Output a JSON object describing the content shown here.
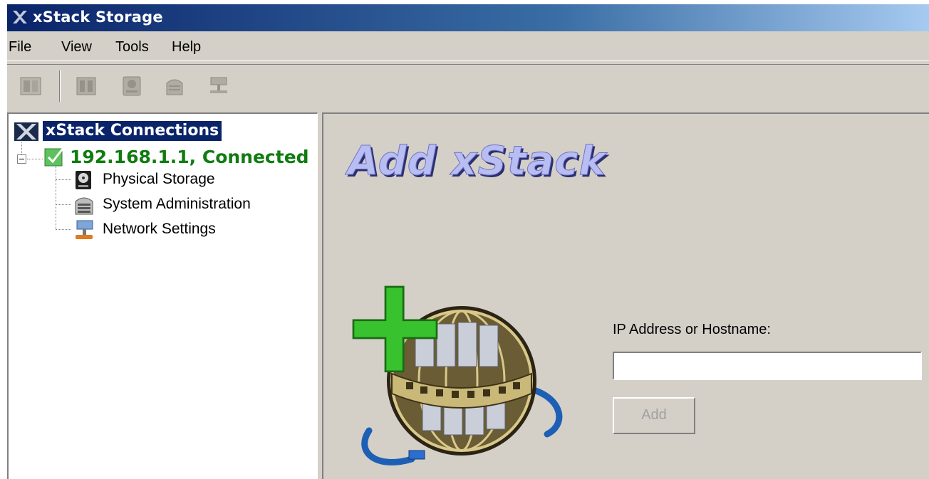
{
  "window": {
    "title": "xStack Storage",
    "title_gradient": [
      "#0a246a",
      "#a6caf0"
    ]
  },
  "menu": {
    "items": [
      "File",
      "View",
      "Tools",
      "Help"
    ]
  },
  "toolbar": {
    "buttons": [
      {
        "icon": "server-icon",
        "enabled": false
      },
      {
        "icon": "storage-array-icon",
        "enabled": false
      },
      {
        "icon": "physical-storage-icon",
        "enabled": false
      },
      {
        "icon": "system-admin-icon",
        "enabled": false
      },
      {
        "icon": "network-icon",
        "enabled": false
      }
    ]
  },
  "tree": {
    "root_label": "xStack Connections",
    "connection": {
      "label": "192.168.1.1, Connected",
      "status_color": "#107c10"
    },
    "children": [
      {
        "label": "Physical Storage",
        "icon": "disk-icon"
      },
      {
        "label": "System Administration",
        "icon": "server-rack-icon"
      },
      {
        "label": "Network Settings",
        "icon": "network-node-icon"
      }
    ]
  },
  "main": {
    "heading": "Add xStack",
    "ip_label": "IP Address or Hostname:",
    "ip_value": "",
    "add_label": "Add",
    "add_enabled": false
  }
}
